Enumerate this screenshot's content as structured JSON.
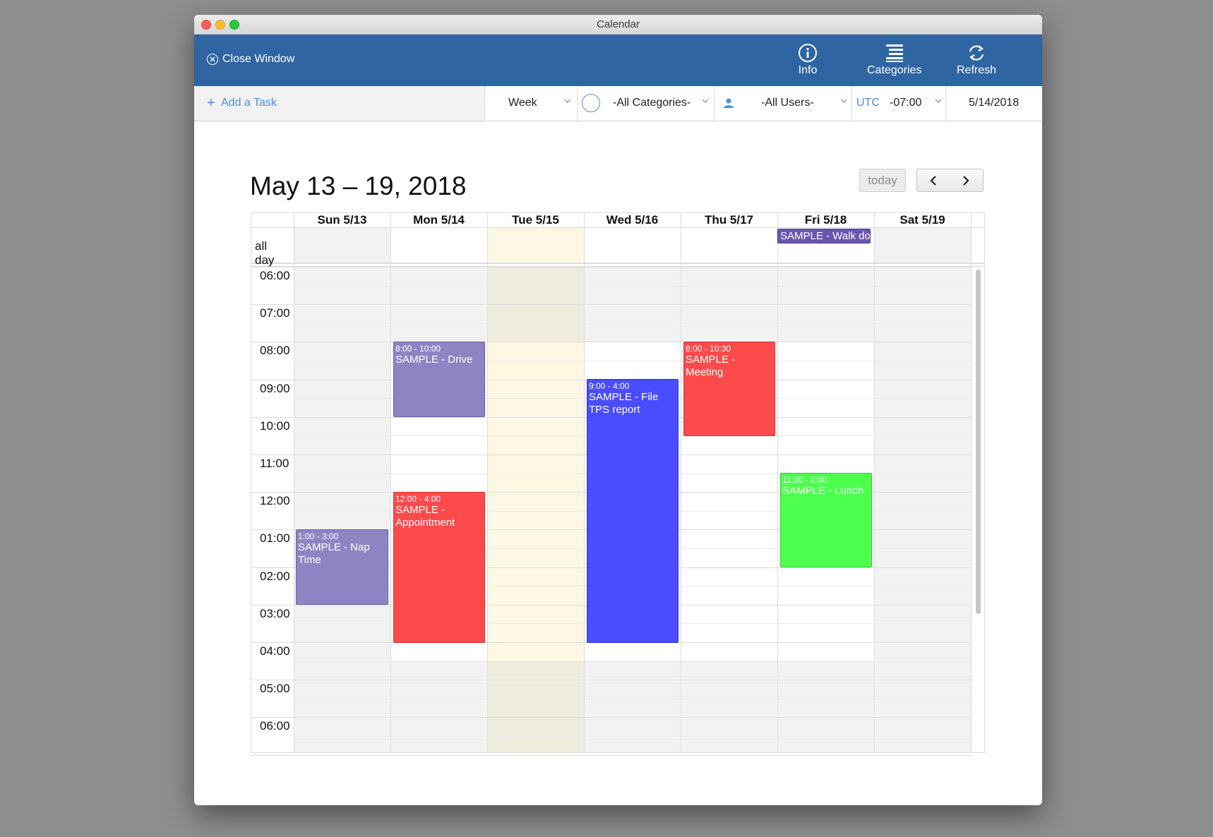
{
  "window": {
    "title": "Calendar"
  },
  "toolbar": {
    "close_label": "Close Window",
    "info_label": "Info",
    "categories_label": "Categories",
    "refresh_label": "Refresh",
    "accent_color": "#2e65a2"
  },
  "filters": {
    "add_task_label": "Add a Task",
    "view": "Week",
    "category": "-All Categories-",
    "users": "-All Users-",
    "utc_label": "UTC",
    "utc_offset": "-07:00",
    "date": "5/14/2018"
  },
  "calendar": {
    "title": "May 13 – 19, 2018",
    "today_label": "today",
    "allday_label": "all day",
    "days": [
      "Sun 5/13",
      "Mon 5/14",
      "Tue 5/15",
      "Wed 5/16",
      "Thu 5/17",
      "Fri 5/18",
      "Sat 5/19"
    ],
    "times": [
      "06:00",
      "07:00",
      "08:00",
      "09:00",
      "10:00",
      "11:00",
      "12:00",
      "01:00",
      "02:00",
      "03:00",
      "04:00",
      "05:00",
      "06:00"
    ],
    "today_highlight_color": "#fcf8e3",
    "allday_events": [
      {
        "day": "Fri 5/18",
        "title": "SAMPLE - Walk dog"
      }
    ],
    "events": [
      {
        "day": "Mon 5/14",
        "time": "8:00 - 10:00",
        "title": "SAMPLE - Drive",
        "color": "#8f84c3"
      },
      {
        "day": "Mon 5/14",
        "time": "12:00 - 4:00",
        "title": "SAMPLE - Appointment",
        "color": "#ff4a4c"
      },
      {
        "day": "Sun 5/13",
        "time": "1:00 - 3:00",
        "title": "SAMPLE - Nap Time",
        "color": "#8f84c3"
      },
      {
        "day": "Wed 5/16",
        "time": "9:00 - 4:00",
        "title": "SAMPLE - File TPS report",
        "color": "#4a4cff"
      },
      {
        "day": "Thu 5/17",
        "time": "8:00 - 10:30",
        "title": "SAMPLE - Meeting",
        "color": "#ff4a4c"
      },
      {
        "day": "Fri 5/18",
        "time": "11:30 - 2:00",
        "title": "SAMPLE - Lunch",
        "color": "#4dff4f"
      }
    ]
  }
}
